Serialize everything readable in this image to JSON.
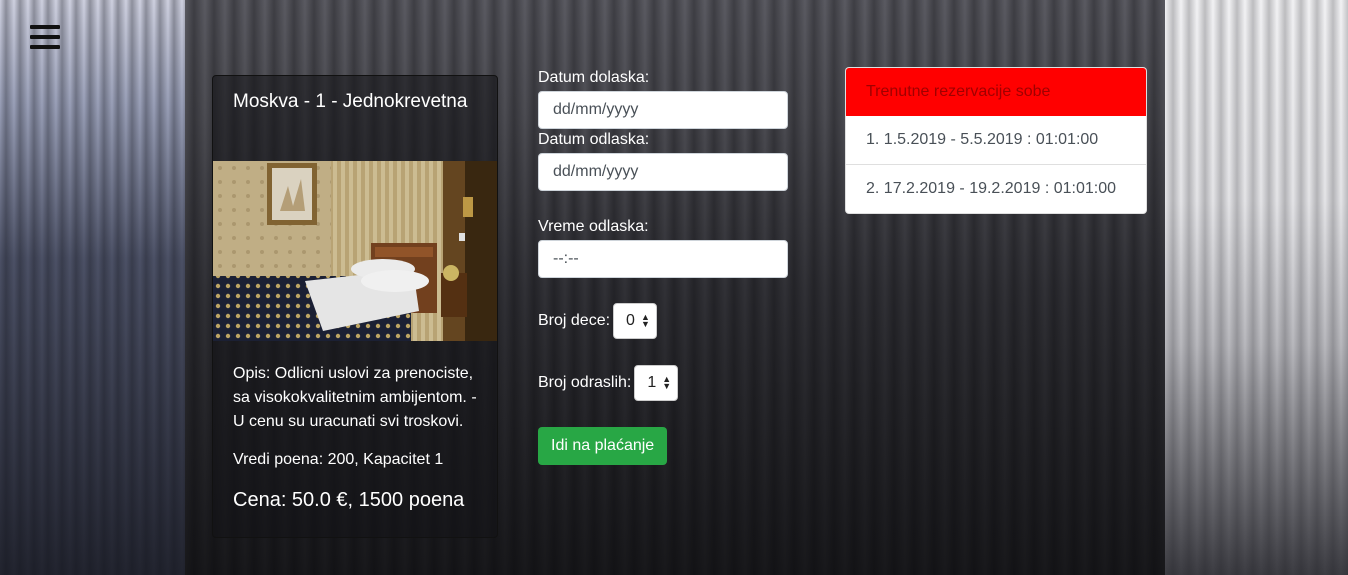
{
  "nav": {
    "menu_icon": "hamburger-menu-icon"
  },
  "room": {
    "title": "Moskva - 1 - Jednokrevetna",
    "description": "Opis: Odlicni uslovi za prenociste, sa visokokvalitetnim ambijentom. - U cenu su uracunati svi troskovi.",
    "points_capacity": "Vredi poena: 200, Kapacitet 1",
    "price": "Cena: 50.0 €, 1500 poena"
  },
  "form": {
    "arrival_label": "Datum dolaska:",
    "arrival_placeholder": "dd/mm/yyyy",
    "departure_label": "Datum odlaska:",
    "departure_placeholder": "dd/mm/yyyy",
    "time_label": "Vreme odlaska:",
    "time_placeholder": "--:--",
    "children_label": "Broj dece:",
    "children_value": "0",
    "adults_label": "Broj odraslih:",
    "adults_value": "1",
    "submit_label": "Idi na plaćanje"
  },
  "reservations": {
    "title": "Trenutne rezervacije sobe",
    "items": [
      "1. 1.5.2019 - 5.5.2019 : 01:01:00",
      "2. 17.2.2019 - 19.2.2019 : 01:01:00"
    ]
  },
  "colors": {
    "submit": "#28a745",
    "reservations_header": "#ff0000"
  }
}
